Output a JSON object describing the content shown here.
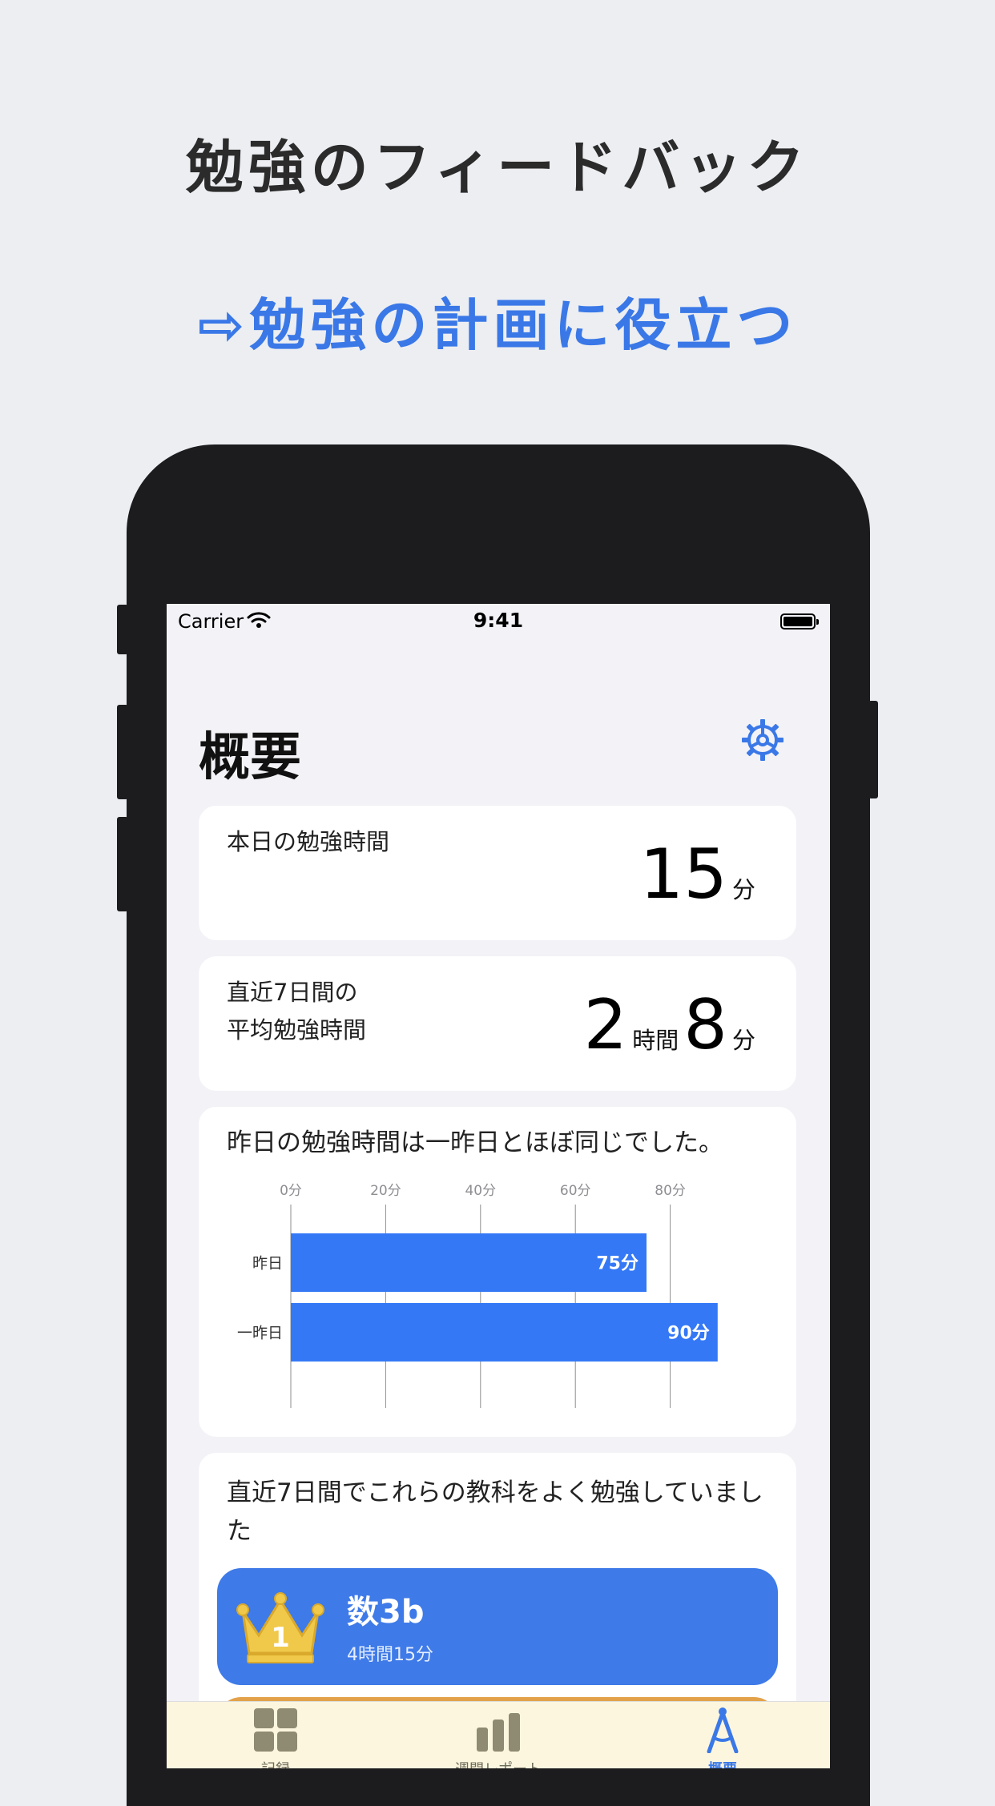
{
  "headline": "勉強のフィードバック",
  "subheadline": "⇨勉強の計画に役立つ",
  "status_bar": {
    "carrier": "Carrier",
    "time": "9:41"
  },
  "page": {
    "title": "概要"
  },
  "today": {
    "label": "本日の勉強時間",
    "minutes": "15",
    "minutes_unit": "分"
  },
  "average": {
    "label_line1": "直近7日間の",
    "label_line2": "平均勉強時間",
    "hours": "2",
    "hours_unit": "時間",
    "minutes": "8",
    "minutes_unit": "分"
  },
  "comparison": {
    "message": "昨日の勉強時間は一昨日とほぼ同じでした。"
  },
  "chart_data": {
    "type": "bar",
    "orientation": "horizontal",
    "categories": [
      "昨日",
      "一昨日"
    ],
    "values": [
      75,
      90
    ],
    "value_labels": [
      "75分",
      "90分"
    ],
    "tick_labels": [
      "0分",
      "20分",
      "40分",
      "60分",
      "80分"
    ],
    "xlim": [
      0,
      100
    ],
    "grid": true,
    "color": "#3478f6"
  },
  "subjects": {
    "message": "直近7日間でこれらの教科をよく勉強していました",
    "ranking": [
      {
        "rank": "1",
        "name": "数3b",
        "time": "4時間15分",
        "color": "#3e7ae8"
      },
      {
        "color": "#e3a24a"
      }
    ]
  },
  "tabbar": {
    "tabs": [
      {
        "label": "記録",
        "icon": "grid-icon"
      },
      {
        "label": "週間レポート",
        "icon": "bar-chart-icon"
      },
      {
        "label": "概要",
        "icon": "compass-icon",
        "active": true
      }
    ]
  },
  "colors": {
    "accent": "#3a78e7",
    "background": "#f2f2f7",
    "card": "#ffffff"
  }
}
